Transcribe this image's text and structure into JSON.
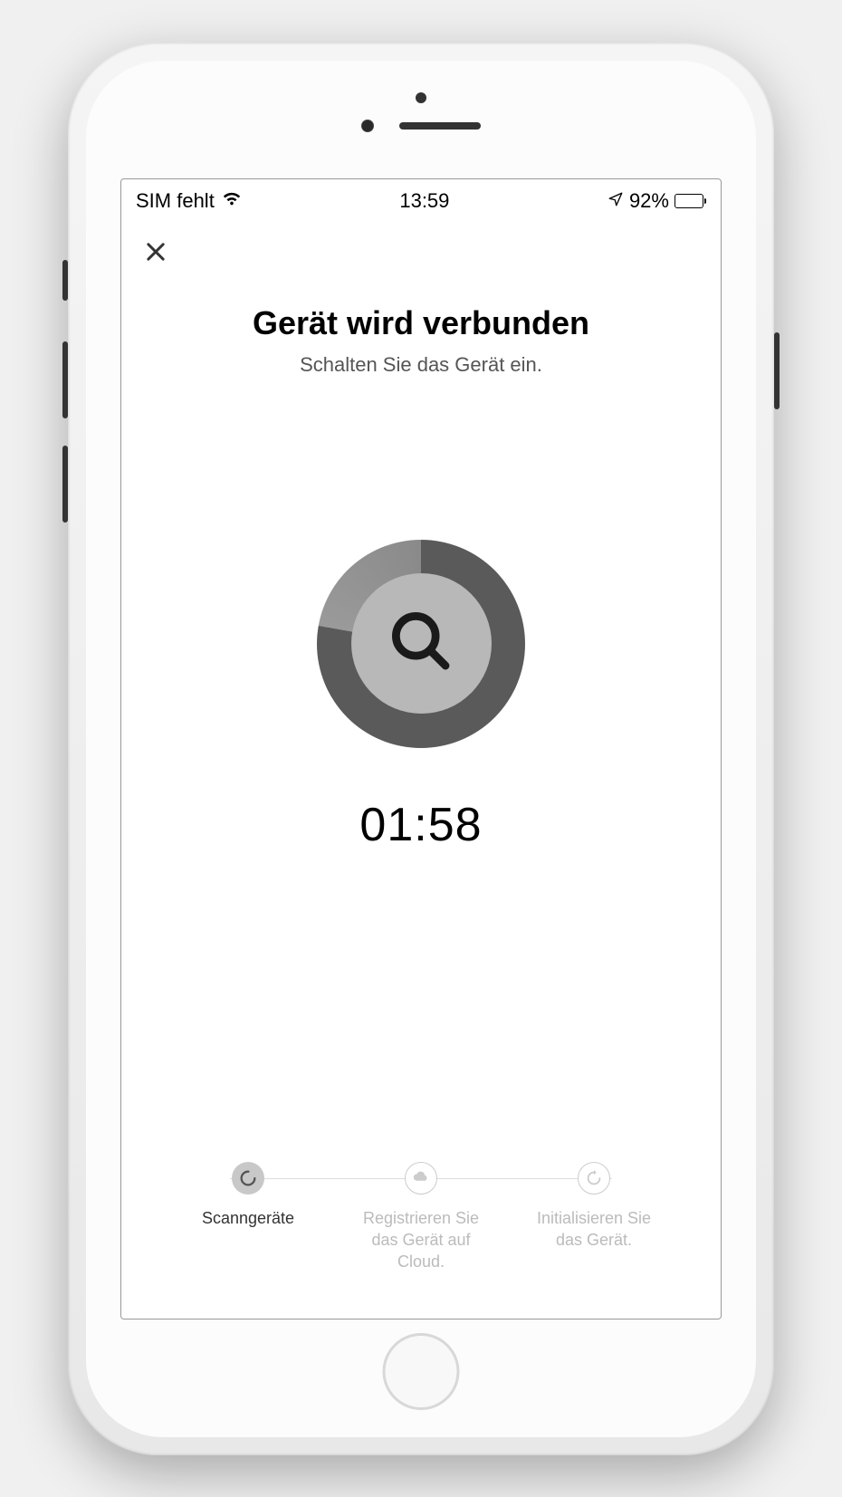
{
  "statusBar": {
    "carrier": "SIM fehlt",
    "time": "13:59",
    "battery": "92%"
  },
  "header": {
    "title": "Gerät wird verbunden",
    "subtitle": "Schalten Sie das Gerät ein."
  },
  "timer": "01:58",
  "steps": [
    {
      "label": "Scanngeräte",
      "active": true,
      "icon": "spinner"
    },
    {
      "label": "Registrieren Sie das Gerät auf Cloud.",
      "active": false,
      "icon": "cloud"
    },
    {
      "label": "Initialisieren Sie das Gerät.",
      "active": false,
      "icon": "refresh"
    }
  ]
}
